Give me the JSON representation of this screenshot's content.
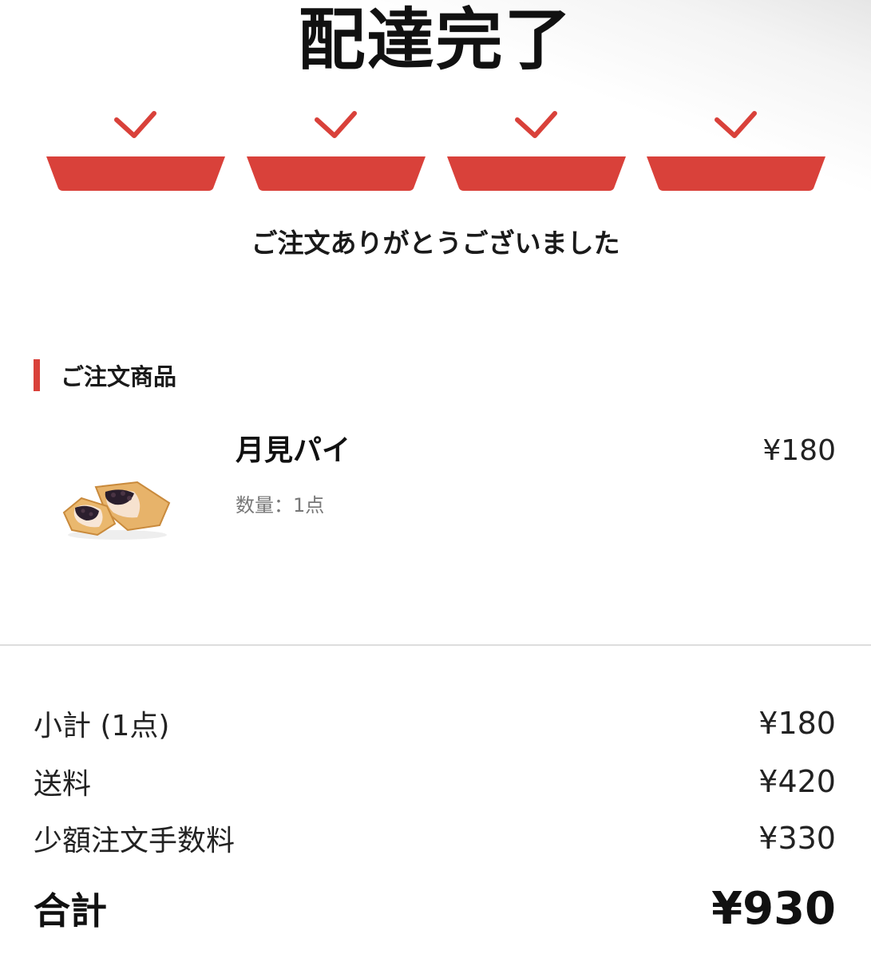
{
  "header": {
    "title": "配達完了"
  },
  "progress": {
    "steps_completed": 4,
    "steps_total": 4,
    "accent_color": "#d9413a",
    "check_icon": "check-icon"
  },
  "thanks_message": "ご注文ありがとうございました",
  "order": {
    "section_title": "ご注文商品",
    "items": [
      {
        "name": "月見パイ",
        "price": "¥180",
        "quantity": "数量：1点",
        "image": "pie-image"
      }
    ]
  },
  "summary": {
    "subtotal_label": "小計 (1点)",
    "subtotal_value": "¥180",
    "shipping_label": "送料",
    "shipping_value": "¥420",
    "small_order_fee_label": "少額注文手数料",
    "small_order_fee_value": "¥330",
    "total_label": "合計",
    "total_value": "¥930"
  }
}
